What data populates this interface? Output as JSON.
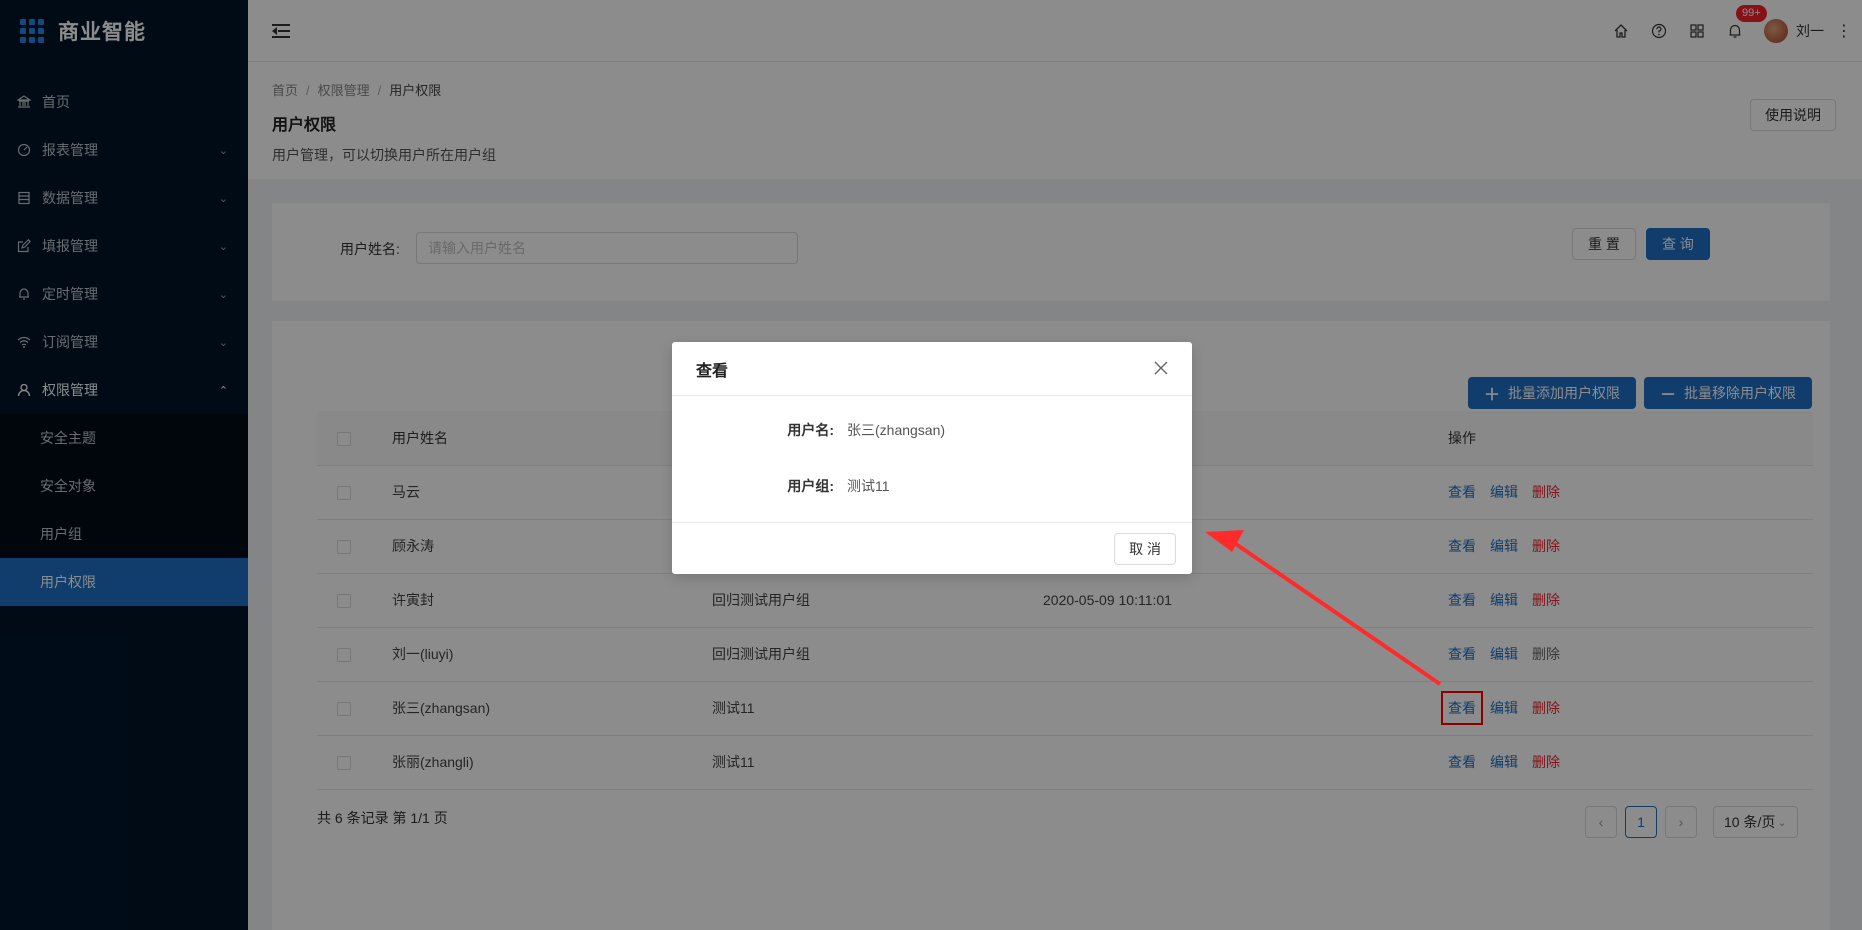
{
  "app": {
    "title": "商业智能"
  },
  "sidebar": {
    "items": [
      {
        "label": "首页",
        "icon": "bank-icon"
      },
      {
        "label": "报表管理",
        "icon": "dashboard-icon"
      },
      {
        "label": "数据管理",
        "icon": "database-icon"
      },
      {
        "label": "填报管理",
        "icon": "edit-icon"
      },
      {
        "label": "定时管理",
        "icon": "bell-icon"
      },
      {
        "label": "订阅管理",
        "icon": "wifi-icon"
      },
      {
        "label": "权限管理",
        "icon": "user-icon"
      }
    ],
    "submenu": [
      "安全主题",
      "安全对象",
      "用户组",
      "用户权限"
    ]
  },
  "topbar": {
    "badge": "99+",
    "user_name": "刘一"
  },
  "page": {
    "breadcrumb": [
      "首页",
      "权限管理",
      "用户权限"
    ],
    "title": "用户权限",
    "description": "用户管理，可以切换用户所在用户组",
    "help_button": "使用说明"
  },
  "search": {
    "label": "用户姓名:",
    "placeholder": "请输入用户姓名",
    "reset": "重 置",
    "query": "查 询"
  },
  "toolbar": {
    "bulk_add": "批量添加用户权限",
    "bulk_remove": "批量移除用户权限"
  },
  "table": {
    "headers": {
      "name": "用户姓名",
      "ops": "操作"
    },
    "rows": [
      {
        "name": "马云",
        "group": "",
        "time": ""
      },
      {
        "name": "顾永涛",
        "group": "",
        "time": ""
      },
      {
        "name": "许寅封",
        "group": "回归测试用户组",
        "time": "2020-05-09 10:11:01"
      },
      {
        "name": "刘一(liuyi)",
        "group": "回归测试用户组",
        "time": ""
      },
      {
        "name": "张三(zhangsan)",
        "group": "测试11",
        "time": ""
      },
      {
        "name": "张丽(zhangli)",
        "group": "测试11",
        "time": ""
      }
    ],
    "actions": {
      "view": "查看",
      "edit": "编辑",
      "delete": "删除"
    }
  },
  "pagination": {
    "summary": "共 6 条记录 第 1/1 页",
    "current": "1",
    "page_size": "10 条/页"
  },
  "modal": {
    "title": "查看",
    "username_label": "用户名:",
    "username_value": "张三(zhangsan)",
    "group_label": "用户组:",
    "group_value": "测试11",
    "cancel": "取 消"
  },
  "colors": {
    "primary": "#1e6fc4",
    "sidebar": "#001529",
    "danger": "#f5222d",
    "annotation": "#ff0000"
  }
}
